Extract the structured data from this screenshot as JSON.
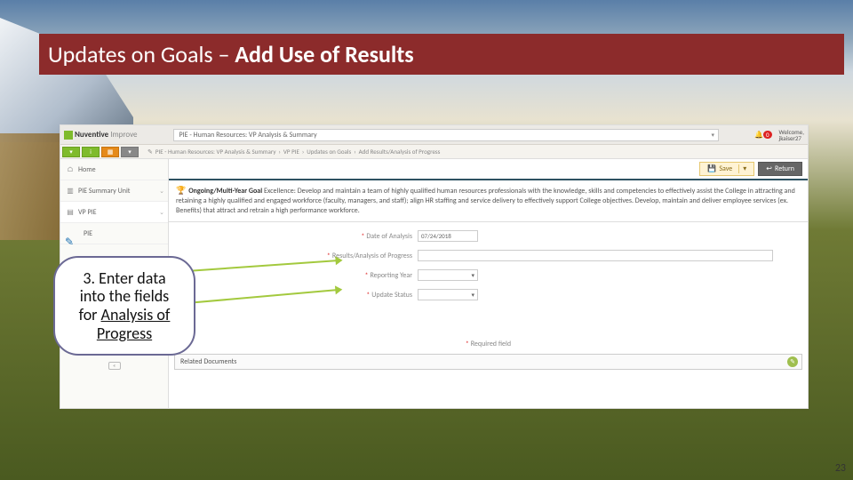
{
  "slide": {
    "title_plain": "Updates on Goals – ",
    "title_bold": "Add Use of Results",
    "page_number": "23"
  },
  "callout": {
    "line1": "3. Enter data",
    "line2": "into the fields",
    "line3": "for ",
    "underline1": "Analysis of",
    "underline2": "Progress"
  },
  "app": {
    "brand1": "Nuventive",
    "brand2": "Improve",
    "unit_picker": "PIE - Human Resources: VP Analysis & Summary",
    "notif_count": "0",
    "welcome_label": "Welcome,",
    "welcome_user": "jkaiser27",
    "breadcrumb": {
      "pen": "✎",
      "b1": "PIE - Human Resources: VP Analysis & Summary",
      "sep": "›",
      "b2": "VP PIE",
      "b3": "Updates on Goals",
      "b4": "Add Results/Analysis of Progress"
    },
    "sidenav": {
      "home": "Home",
      "summary": "PIE Summary Unit",
      "vppie": "VP PIE",
      "sub": "PIE"
    },
    "actions": {
      "save": "Save",
      "return": "Return"
    },
    "goal": {
      "label": "Ongoing/Multi-Year Goal",
      "text": " Excellence: Develop and maintain a team of highly qualified human resources professionals with the knowledge, skills and competencies to effectively assist the College in attracting and retaining a highly qualified and engaged workforce (faculty, managers, and staff); align HR staffing and service delivery to effectively support College objectives. Develop, maintain and deliver employee services (ex. Benefits) that attract and retrain a high performance workforce."
    },
    "form": {
      "date_label": "Date of Analysis",
      "date_value": "07/24/2018",
      "results_label": "Results/Analysis of Progress",
      "year_label": "Reporting Year",
      "status_label": "Update Status",
      "required_hint": "Required field"
    },
    "reldocs": "Related Documents"
  }
}
